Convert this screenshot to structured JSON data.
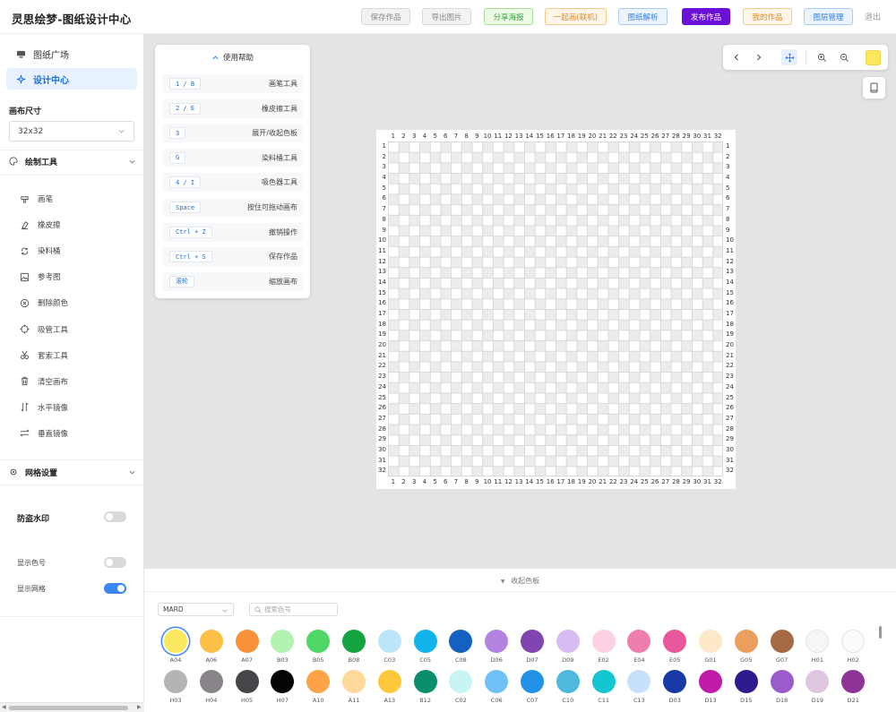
{
  "header": {
    "title": "灵思绘梦-图纸设计中心",
    "buttons": [
      {
        "label": "保存作品",
        "color": "#888888",
        "bg": "#f2f2f2",
        "border": "#d9d9d9"
      },
      {
        "label": "导出图片",
        "color": "#888888",
        "bg": "#f2f2f2",
        "border": "#d9d9d9"
      },
      {
        "label": "分享海报",
        "color": "#3aa33a",
        "bg": "#eefae8",
        "border": "#a8dd96"
      },
      {
        "label": "一起画(联机)",
        "color": "#e0892b",
        "bg": "#fff5e8",
        "border": "#f6c98c"
      },
      {
        "label": "图纸解析",
        "color": "#2f7fd8",
        "bg": "#ecf4ff",
        "border": "#a9ccf5"
      },
      {
        "label": "发布作品",
        "color": "#ffffff",
        "bg": "#6a10d8",
        "border": "#6a10d8"
      },
      {
        "label": "我的作品",
        "color": "#e0892b",
        "bg": "#fff5e8",
        "border": "#f6c98c"
      },
      {
        "label": "图层管理",
        "color": "#2f7fd8",
        "bg": "#ecf4ff",
        "border": "#a9ccf5"
      }
    ],
    "logout": "退出"
  },
  "sidebar": {
    "nav": [
      {
        "label": "图纸广场",
        "icon": "monitor-icon",
        "active": false
      },
      {
        "label": "设计中心",
        "icon": "sparkle-icon",
        "active": true
      }
    ],
    "canvas_size": {
      "label": "画布尺寸",
      "value": "32x32"
    },
    "draw_tools": {
      "title": "绘制工具",
      "items": [
        {
          "label": "画笔",
          "icon": "brush-icon"
        },
        {
          "label": "橡皮擦",
          "icon": "eraser-icon"
        },
        {
          "label": "染料桶",
          "icon": "bucket-icon"
        },
        {
          "label": "参考图",
          "icon": "image-icon"
        },
        {
          "label": "删除颜色",
          "icon": "remove-color-icon"
        },
        {
          "label": "吸管工具",
          "icon": "eyedropper-icon"
        },
        {
          "label": "套索工具",
          "icon": "lasso-icon"
        },
        {
          "label": "清空画布",
          "icon": "trash-icon"
        },
        {
          "label": "水平镜像",
          "icon": "flip-horizontal-icon"
        },
        {
          "label": "垂直镜像",
          "icon": "flip-vertical-icon"
        }
      ]
    },
    "grid_settings": {
      "title": "网格设置",
      "watermark": {
        "label": "防盗水印",
        "on": false
      },
      "show_code": {
        "label": "显示色号",
        "on": false
      },
      "show_grid": {
        "label": "显示网格",
        "on": true
      }
    }
  },
  "help_panel": {
    "title": "使用帮助",
    "rows": [
      {
        "key": "1 / B",
        "desc": "画笔工具"
      },
      {
        "key": "2 / E",
        "desc": "橡皮擦工具"
      },
      {
        "key": "3",
        "desc": "展开/收起色板"
      },
      {
        "key": "G",
        "desc": "染料桶工具"
      },
      {
        "key": "4 / I",
        "desc": "吸色器工具"
      },
      {
        "key": "Space",
        "desc": "按住可拖动画布"
      },
      {
        "key": "Ctrl + Z",
        "desc": "撤销操作"
      },
      {
        "key": "Ctrl + S",
        "desc": "保存作品"
      },
      {
        "key": "滚轮",
        "desc": "缩放画布"
      }
    ]
  },
  "view_controls": {
    "icons": [
      "chevron-left-icon",
      "chevron-right-icon",
      "move-icon",
      "zoom-in-icon",
      "zoom-out-icon"
    ],
    "current_color": "#fce85e"
  },
  "canvas": {
    "cols": 32,
    "rows": 32
  },
  "palette": {
    "toggle_label": "收起色板",
    "brand": "MARD",
    "search_placeholder": "搜索色号",
    "selected": "A04",
    "colors": [
      {
        "code": "A04",
        "hex": "#fce85e"
      },
      {
        "code": "A06",
        "hex": "#fbbf45"
      },
      {
        "code": "A07",
        "hex": "#f7923b"
      },
      {
        "code": "B03",
        "hex": "#b3f1b1"
      },
      {
        "code": "B05",
        "hex": "#4ed766"
      },
      {
        "code": "B08",
        "hex": "#13a341"
      },
      {
        "code": "C03",
        "hex": "#bde6fa"
      },
      {
        "code": "C05",
        "hex": "#10b3ea"
      },
      {
        "code": "C08",
        "hex": "#1561c2"
      },
      {
        "code": "D06",
        "hex": "#b284df"
      },
      {
        "code": "D07",
        "hex": "#8045b0"
      },
      {
        "code": "D09",
        "hex": "#d8bdf3"
      },
      {
        "code": "E02",
        "hex": "#fdd0e4"
      },
      {
        "code": "E04",
        "hex": "#ee7eab"
      },
      {
        "code": "E05",
        "hex": "#e8579b"
      },
      {
        "code": "G01",
        "hex": "#fde8c8"
      },
      {
        "code": "G05",
        "hex": "#eb9f5c"
      },
      {
        "code": "G07",
        "hex": "#a36a43"
      },
      {
        "code": "H01",
        "hex": "#f6f5f7"
      },
      {
        "code": "H02",
        "hex": "#fbfbfb"
      },
      {
        "code": "H03",
        "hex": "#b4b4b4"
      },
      {
        "code": "H04",
        "hex": "#898489"
      },
      {
        "code": "H05",
        "hex": "#474549"
      },
      {
        "code": "H07",
        "hex": "#050505"
      },
      {
        "code": "A10",
        "hex": "#fca447"
      },
      {
        "code": "A11",
        "hex": "#fed99a"
      },
      {
        "code": "A13",
        "hex": "#fec93c"
      },
      {
        "code": "B12",
        "hex": "#0a8f6a"
      },
      {
        "code": "C02",
        "hex": "#c9f4f4"
      },
      {
        "code": "C06",
        "hex": "#6ec0f5"
      },
      {
        "code": "C07",
        "hex": "#2391e6"
      },
      {
        "code": "C10",
        "hex": "#4fb8de"
      },
      {
        "code": "C11",
        "hex": "#14c5d2"
      },
      {
        "code": "C13",
        "hex": "#c8e1fa"
      },
      {
        "code": "D03",
        "hex": "#1838a8"
      },
      {
        "code": "D13",
        "hex": "#c11aa9"
      },
      {
        "code": "D15",
        "hex": "#2e1c8f"
      },
      {
        "code": "D18",
        "hex": "#9a5ccd"
      },
      {
        "code": "D19",
        "hex": "#ddc6de"
      },
      {
        "code": "D21",
        "hex": "#8f3396"
      }
    ]
  }
}
